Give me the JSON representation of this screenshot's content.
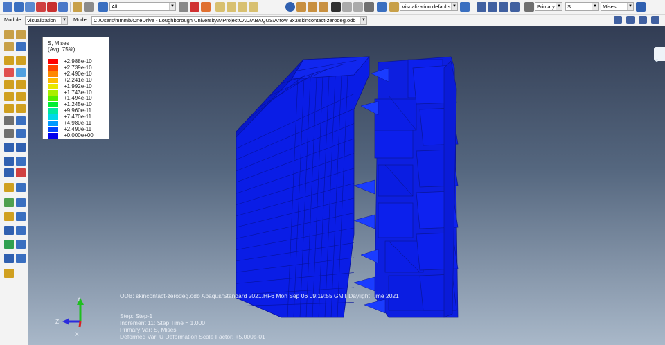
{
  "toolbar": {
    "filter_select": "All",
    "view_defaults": "Visualization defaults",
    "primary_select": "Primary",
    "s_select": "S",
    "mises_select": "Mises"
  },
  "modulebar": {
    "module_label": "Module:",
    "module_value": "Visualization",
    "model_label": "Model:",
    "model_value": "C:/Users/mmmb/OneDrive - Loughborough University/MProjectCAD/ABAQUS/Arrow 3x3/skincontact-zerodeg.odb"
  },
  "legend": {
    "title": "S, Mises",
    "subtitle": "(Avg: 75%)",
    "levels": [
      {
        "value": "+2.988e-10",
        "color": "#ff0000"
      },
      {
        "value": "+2.739e-10",
        "color": "#ff4400"
      },
      {
        "value": "+2.490e-10",
        "color": "#ff8800"
      },
      {
        "value": "+2.241e-10",
        "color": "#ffbb00"
      },
      {
        "value": "+1.992e-10",
        "color": "#e8e800"
      },
      {
        "value": "+1.743e-10",
        "color": "#aaee00"
      },
      {
        "value": "+1.494e-10",
        "color": "#55ee00"
      },
      {
        "value": "+1.245e-10",
        "color": "#00ee33"
      },
      {
        "value": "+9.960e-11",
        "color": "#00e8a0"
      },
      {
        "value": "+7.470e-11",
        "color": "#00d8e8"
      },
      {
        "value": "+4.980e-11",
        "color": "#0099ff"
      },
      {
        "value": "+2.490e-11",
        "color": "#0044ff"
      },
      {
        "value": "+0.000e+00",
        "color": "#0000ee"
      }
    ]
  },
  "odb_info": {
    "odb_line": "ODB: skincontact-zerodeg.odb    Abaqus/Standard 2021.HF6    Mon Sep 06 09:19:55 GMT Daylight Time 2021",
    "step_line": "Step: Step-1",
    "increment_line": "Increment     11: Step Time =      1.000",
    "primary_line": "Primary Var: S, Mises",
    "deformed_line": "Deformed Var: U   Deformation Scale Factor: +5.000e-01"
  },
  "triad": {
    "y": "Y",
    "z": "Z",
    "x": "X"
  },
  "colors": {
    "mesh_fill": "#0a1de6",
    "mesh_line": "#07129a",
    "viewport_top": "#323d54",
    "viewport_bottom": "#a9b8c9"
  }
}
